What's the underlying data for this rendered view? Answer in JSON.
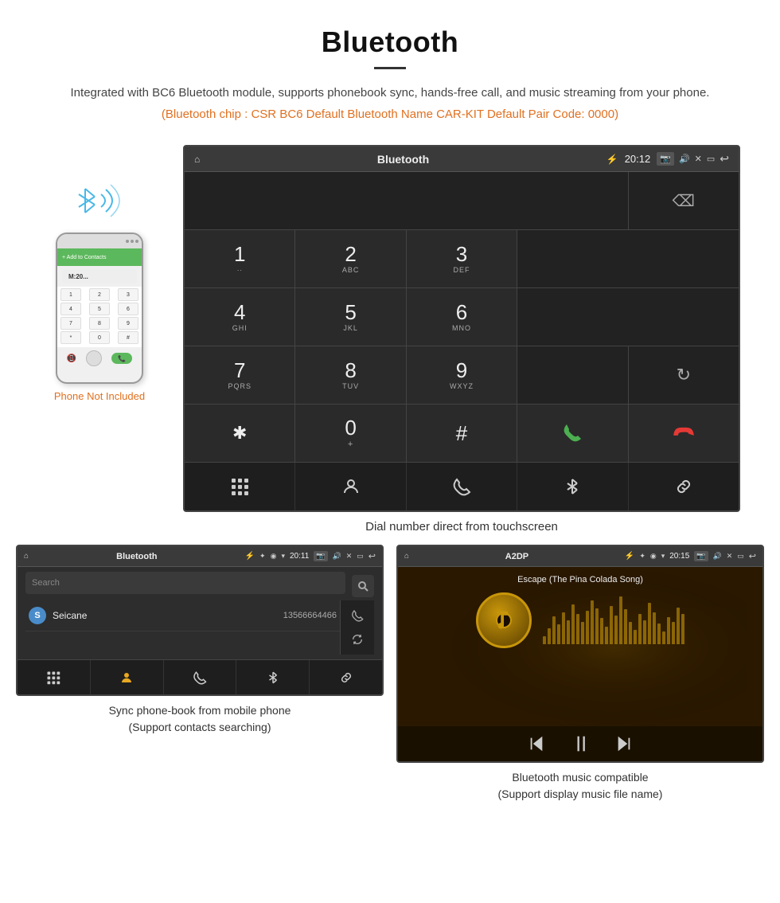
{
  "page": {
    "title": "Bluetooth",
    "description": "Integrated with BC6 Bluetooth module, supports phonebook sync, hands-free call, and music streaming from your phone.",
    "specs": "(Bluetooth chip : CSR BC6    Default Bluetooth Name CAR-KIT    Default Pair Code: 0000)",
    "screen_caption": "Dial number direct from touchscreen",
    "phone_not_included": "Phone Not Included"
  },
  "dialpad_screen": {
    "status_bar": {
      "home_icon": "⌂",
      "title": "Bluetooth",
      "usb_icon": "⚡",
      "bt_icon": "✦",
      "location_icon": "◉",
      "wifi_icon": "▾",
      "time": "20:12",
      "camera_icon": "📷",
      "volume_icon": "🔊",
      "close_icon": "✕",
      "window_icon": "▭",
      "back_icon": "↩"
    },
    "keys": [
      {
        "num": "1",
        "sub": "∙∙"
      },
      {
        "num": "2",
        "sub": "ABC"
      },
      {
        "num": "3",
        "sub": "DEF"
      },
      {
        "num": "",
        "sub": ""
      },
      {
        "num": "⌫",
        "sub": ""
      },
      {
        "num": "4",
        "sub": "GHI"
      },
      {
        "num": "5",
        "sub": "JKL"
      },
      {
        "num": "6",
        "sub": "MNO"
      },
      {
        "num": "",
        "sub": ""
      },
      {
        "num": "",
        "sub": ""
      },
      {
        "num": "7",
        "sub": "PQRS"
      },
      {
        "num": "8",
        "sub": "TUV"
      },
      {
        "num": "9",
        "sub": "WXYZ"
      },
      {
        "num": "",
        "sub": ""
      },
      {
        "num": "↻",
        "sub": ""
      },
      {
        "num": "✱",
        "sub": ""
      },
      {
        "num": "0",
        "sub": "+"
      },
      {
        "num": "#",
        "sub": ""
      },
      {
        "num": "📞",
        "sub": ""
      },
      {
        "num": "📞",
        "sub": "end"
      }
    ],
    "func_bar": [
      "⊞",
      "👤",
      "📞",
      "✦",
      "🔗"
    ]
  },
  "phonebook_screen": {
    "status_bar": {
      "home_icon": "⌂",
      "title": "Bluetooth",
      "usb_icon": "⚡",
      "bt_icon": "✦",
      "location_icon": "◉",
      "wifi_icon": "▾",
      "time": "20:11",
      "camera_icon": "📷",
      "volume_icon": "🔊",
      "close_icon": "✕",
      "window_icon": "▭",
      "back_icon": "↩"
    },
    "search_placeholder": "Search",
    "contact": {
      "letter": "S",
      "name": "Seicane",
      "number": "13566664466"
    },
    "caption_line1": "Sync phone-book from mobile phone",
    "caption_line2": "(Support contacts searching)"
  },
  "music_screen": {
    "status_bar": {
      "home_icon": "⌂",
      "title": "A2DP",
      "usb_icon": "⚡",
      "bt_icon": "✦",
      "location_icon": "◉",
      "wifi_icon": "▾",
      "time": "20:15",
      "camera_icon": "📷",
      "volume_icon": "🔊",
      "close_icon": "✕",
      "window_icon": "▭",
      "back_icon": "↩"
    },
    "song_title": "Escape (The Pina Colada Song)",
    "viz_heights": [
      10,
      20,
      35,
      25,
      40,
      30,
      50,
      38,
      28,
      42,
      55,
      45,
      33,
      22,
      48,
      36,
      60,
      44,
      28,
      18,
      38,
      30,
      52,
      40,
      26,
      16,
      34,
      28,
      46,
      38
    ],
    "caption_line1": "Bluetooth music compatible",
    "caption_line2": "(Support display music file name)"
  }
}
